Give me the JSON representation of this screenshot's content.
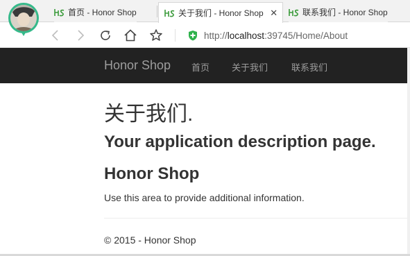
{
  "browser": {
    "tabs": [
      {
        "title": "首页 - Honor Shop",
        "active": false
      },
      {
        "title": "关于我们 - Honor Shop",
        "active": true,
        "close": "✕"
      },
      {
        "title": "联系我们 - Honor Shop",
        "active": false
      }
    ],
    "address_bar": {
      "scheme": "http://",
      "host": "localhost",
      "rest": ":39745/Home/About"
    },
    "icons": [
      "back-arrow-icon",
      "forward-arrow-icon",
      "refresh-icon",
      "home-icon",
      "favorite-star-icon",
      "security-shield-icon",
      "site-favicon",
      "profile-avatar"
    ]
  },
  "navbar": {
    "brand": "Honor Shop",
    "links": [
      "首页",
      "关于我们",
      "联系我们"
    ],
    "background": "#222222",
    "link_color": "#9d9d9d"
  },
  "main": {
    "title": "关于我们.",
    "subtitle": "Your application description page.",
    "section_heading": "Honor Shop",
    "paragraph": "Use this area to provide additional information."
  },
  "footer": {
    "text": "© 2015 - Honor Shop"
  },
  "colors": {
    "shield_green": "#2fb24c",
    "favicon_green": "#3a9a3a"
  }
}
